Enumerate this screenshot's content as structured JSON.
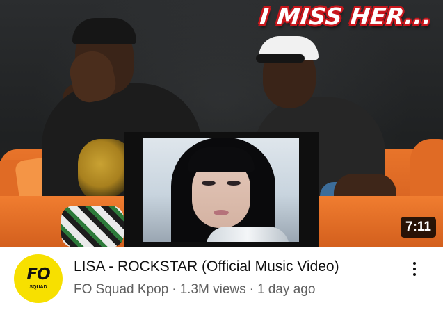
{
  "thumbnail": {
    "overlay_caption": "I MISS HER...",
    "duration": "7:11"
  },
  "channel": {
    "avatar_mark": "FO",
    "avatar_sub": "SQUAD",
    "avatar_color": "#f7e000"
  },
  "video": {
    "title": "LISA - ROCKSTAR (Official Music Video)",
    "channel_name": "FO Squad Kpop",
    "separator": "·",
    "views": "1.3M views",
    "age": "1 day ago"
  },
  "menu": {
    "icon": "more-vert-icon"
  }
}
